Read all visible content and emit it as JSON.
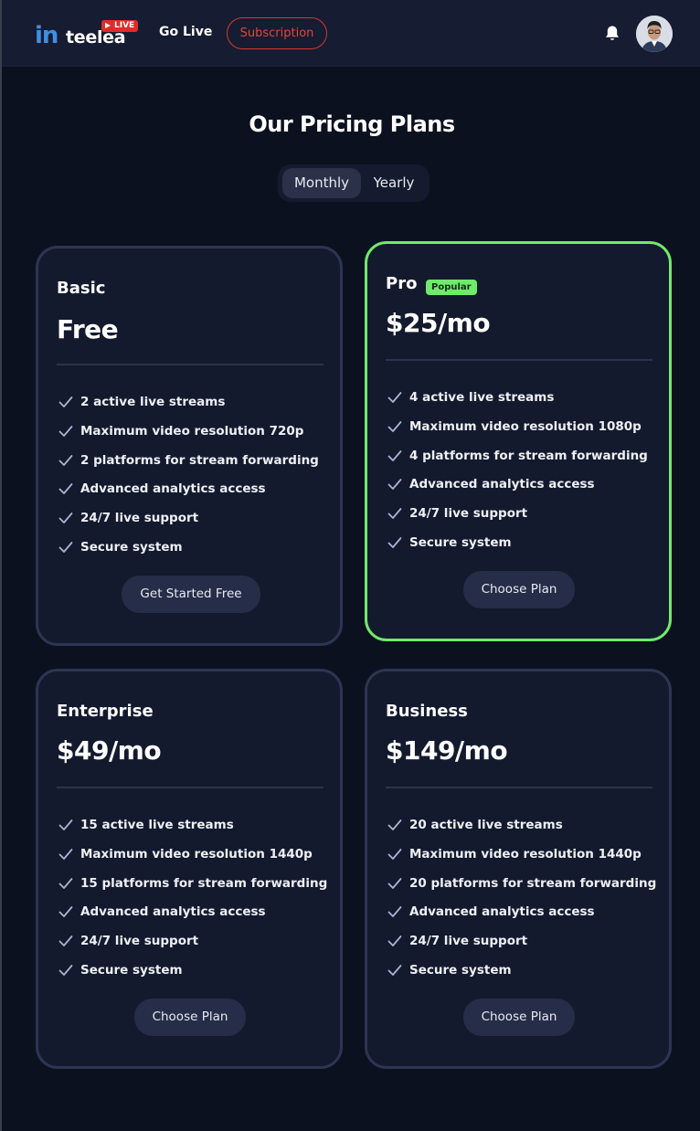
{
  "header": {
    "logo_word": "teelea",
    "logo_badge": "LIVE",
    "go_live": "Go Live",
    "subscription": "Subscription"
  },
  "page_title": "Our Pricing Plans",
  "billing_toggle": {
    "monthly": "Monthly",
    "yearly": "Yearly",
    "selected": "Monthly"
  },
  "plans": [
    {
      "name": "Basic",
      "price": "Free",
      "features": [
        "2 active live streams",
        "Maximum video resolution 720p",
        "2 platforms for stream forwarding",
        "Advanced analytics access",
        "24/7 live support",
        "Secure system"
      ],
      "button": "Get Started Free"
    },
    {
      "name": "Pro",
      "badge": "Popular",
      "price": "$25/mo",
      "features": [
        "4 active live streams",
        "Maximum video resolution 1080p",
        "4 platforms for stream forwarding",
        "Advanced analytics access",
        "24/7 live support",
        "Secure system"
      ],
      "button": "Choose Plan"
    },
    {
      "name": "Enterprise",
      "price": "$49/mo",
      "features": [
        "15 active live streams",
        "Maximum video resolution 1440p",
        "15 platforms for stream forwarding",
        "Advanced analytics access",
        "24/7 live support",
        "Secure system"
      ],
      "button": "Choose Plan"
    },
    {
      "name": "Business",
      "price": "$149/mo",
      "features": [
        "20 active live streams",
        "Maximum video resolution 1440p",
        "20 platforms for stream forwarding",
        "Advanced analytics access",
        "24/7 live support",
        "Secure system"
      ],
      "button": "Choose Plan"
    }
  ],
  "colors": {
    "background": "#0c1120",
    "card": "#141a2e",
    "card_border": "#2c3552",
    "popular_accent": "#6fea6a",
    "subscription_red": "#e2463b",
    "logo_blue": "#3f8fe6"
  },
  "icons": [
    "bell-icon",
    "check-icon",
    "play-icon",
    "avatar"
  ]
}
